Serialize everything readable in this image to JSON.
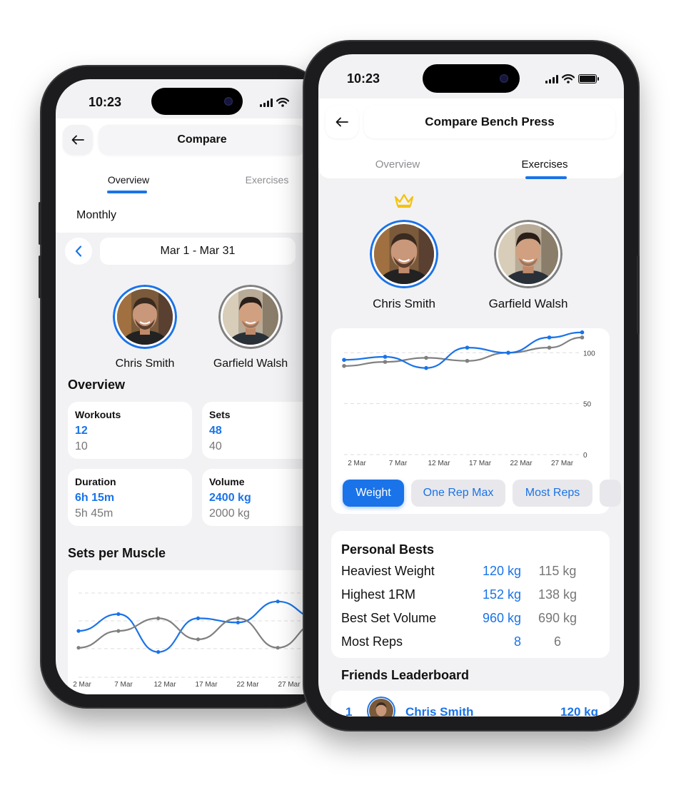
{
  "colors": {
    "accent": "#1a73e8",
    "secondary_line": "#808080",
    "crown": "#f4c20d"
  },
  "left_phone": {
    "status": {
      "time": "10:23"
    },
    "header": {
      "back_icon": "arrow-left-icon",
      "title": "Compare"
    },
    "tabs": [
      {
        "label": "Overview",
        "active": true
      },
      {
        "label": "Exercises",
        "active": false
      }
    ],
    "period": {
      "selected": "Monthly"
    },
    "date_range": {
      "prev_icon": "chevron-left-icon",
      "label": "Mar 1 - Mar 31"
    },
    "people": [
      {
        "name": "Chris Smith",
        "highlight": true
      },
      {
        "name": "Garfield Walsh",
        "highlight": false
      }
    ],
    "overview": {
      "heading": "Overview",
      "stats": [
        {
          "label": "Workouts",
          "a": "12",
          "b": "10"
        },
        {
          "label": "Sets",
          "a": "48",
          "b": "40"
        },
        {
          "label": "Duration",
          "a": "6h 15m",
          "b": "5h 45m"
        },
        {
          "label": "Volume",
          "a": "2400 kg",
          "b": "2000 kg"
        }
      ]
    },
    "sets_per_muscle": {
      "heading": "Sets per Muscle"
    },
    "chart_data": {
      "type": "line",
      "title": "",
      "x": [
        "2 Mar",
        "7 Mar",
        "12 Mar",
        "17 Mar",
        "22 Mar",
        "27 Mar"
      ],
      "series": [
        {
          "values": [
            11,
            15,
            6,
            14,
            13,
            18,
            14
          ],
          "color": "#1a73e8"
        },
        {
          "values": [
            7,
            11,
            14,
            9,
            14,
            7,
            13
          ],
          "color": "#808080"
        }
      ],
      "grid": true
    }
  },
  "right_phone": {
    "status": {
      "time": "10:23"
    },
    "header": {
      "back_icon": "arrow-left-icon",
      "title": "Compare Bench Press"
    },
    "tabs": [
      {
        "label": "Overview",
        "active": false
      },
      {
        "label": "Exercises",
        "active": true
      }
    ],
    "crown_icon": "crown-icon",
    "people": [
      {
        "name": "Chris Smith",
        "highlight": true
      },
      {
        "name": "Garfield Walsh",
        "highlight": false
      }
    ],
    "chart_data": {
      "type": "line",
      "title": "",
      "x": [
        "2 Mar",
        "7 Mar",
        "12 Mar",
        "17 Mar",
        "22 Mar",
        "27 Mar"
      ],
      "y_ticks": [
        "100",
        "50",
        "0"
      ],
      "ylim": [
        0,
        110
      ],
      "series": [
        {
          "x_index": [
            0,
            1,
            2,
            3,
            4,
            5,
            5.8
          ],
          "values": [
            93,
            96,
            85,
            105,
            100,
            115,
            120
          ],
          "color": "#1a73e8"
        },
        {
          "x_index": [
            0,
            1,
            2,
            3,
            4,
            5,
            5.8
          ],
          "values": [
            87,
            91,
            95,
            92,
            100,
            105,
            115
          ],
          "color": "#808080"
        }
      ],
      "grid": true
    },
    "metric_pills": [
      {
        "label": "Weight",
        "active": true
      },
      {
        "label": "One Rep Max",
        "active": false
      },
      {
        "label": "Most Reps",
        "active": false
      }
    ],
    "personal_bests": {
      "heading": "Personal Bests",
      "rows": [
        {
          "name": "Heaviest Weight",
          "a": "120 kg",
          "b": "115 kg"
        },
        {
          "name": "Highest 1RM",
          "a": "152 kg",
          "b": "138 kg"
        },
        {
          "name": "Best Set Volume",
          "a": "960 kg",
          "b": "690 kg"
        },
        {
          "name": "Most Reps",
          "a": "8",
          "b": "6"
        }
      ]
    },
    "leaderboard": {
      "heading": "Friends Leaderboard",
      "rows": [
        {
          "rank": "1",
          "name": "Chris Smith",
          "value": "120 kg"
        }
      ]
    }
  }
}
